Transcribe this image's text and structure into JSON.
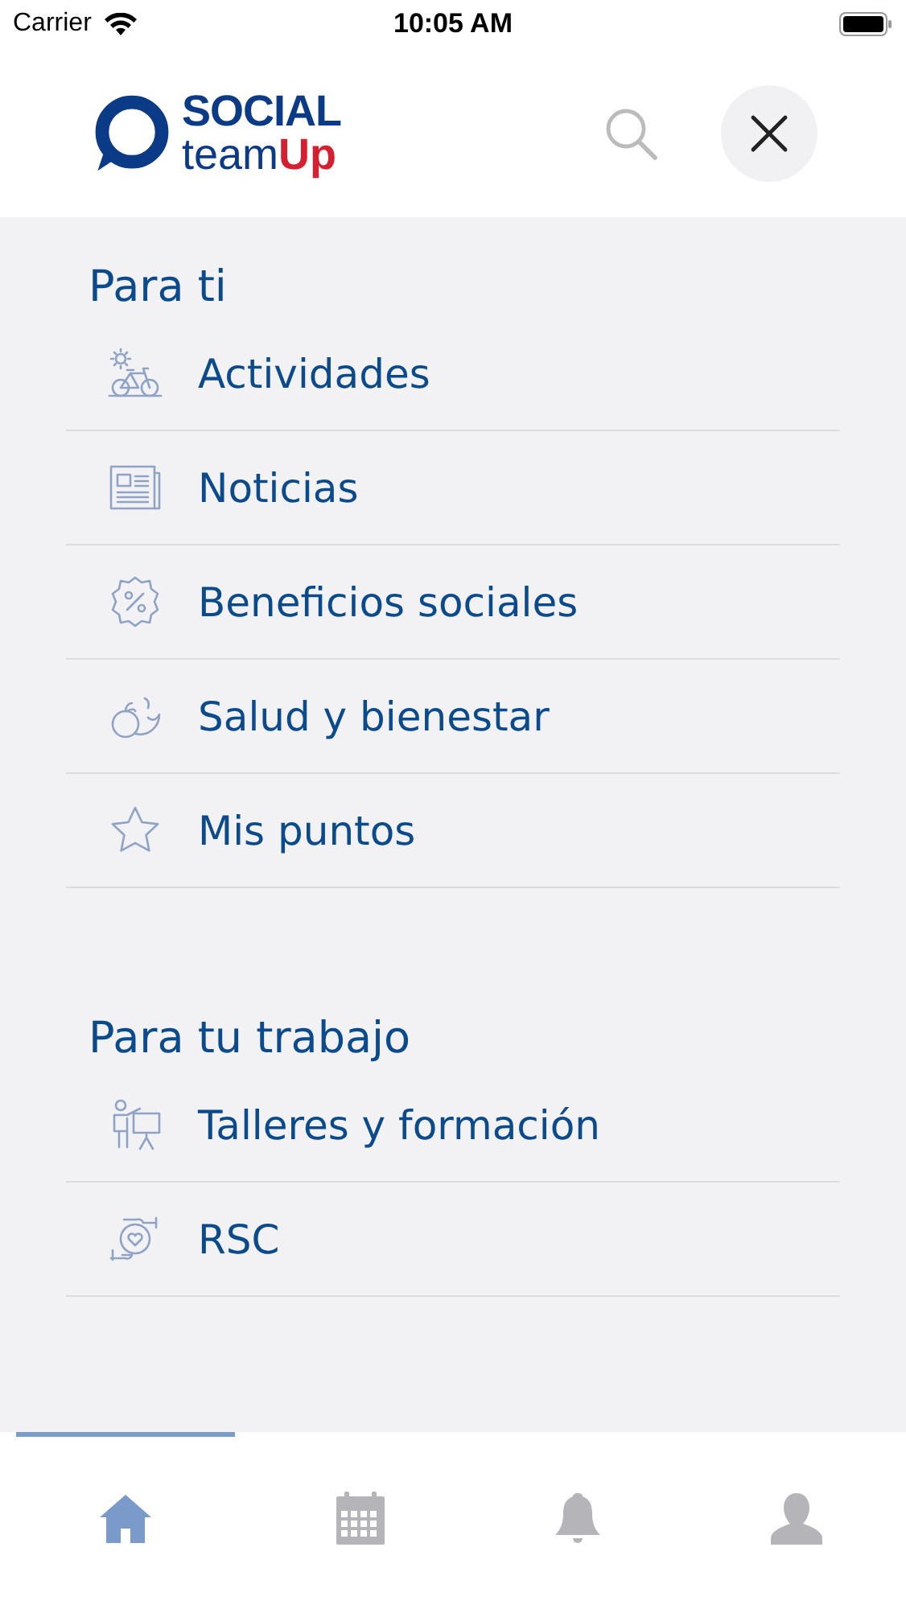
{
  "status_bar": {
    "carrier": "Carrier",
    "time": "10:05 AM"
  },
  "header": {
    "logo": {
      "top": "SOCIAL",
      "bottom_left": "team",
      "bottom_right": "Up"
    }
  },
  "sections": [
    {
      "title": "Para ti",
      "items": [
        {
          "label": "Actividades",
          "kind": "bike"
        },
        {
          "label": "Noticias",
          "kind": "news"
        },
        {
          "label": "Beneficios sociales",
          "kind": "discount"
        },
        {
          "label": "Salud y bienestar",
          "kind": "fruit"
        },
        {
          "label": "Mis puntos",
          "kind": "star"
        }
      ]
    },
    {
      "title": "Para tu trabajo",
      "items": [
        {
          "label": "Talleres y formación",
          "kind": "teacher"
        },
        {
          "label": "RSC",
          "kind": "hands"
        }
      ]
    }
  ],
  "tab_bar": [
    {
      "kind": "home",
      "selected": true
    },
    {
      "kind": "calendar",
      "selected": false
    },
    {
      "kind": "bell",
      "selected": false
    },
    {
      "kind": "profile",
      "selected": false
    }
  ]
}
